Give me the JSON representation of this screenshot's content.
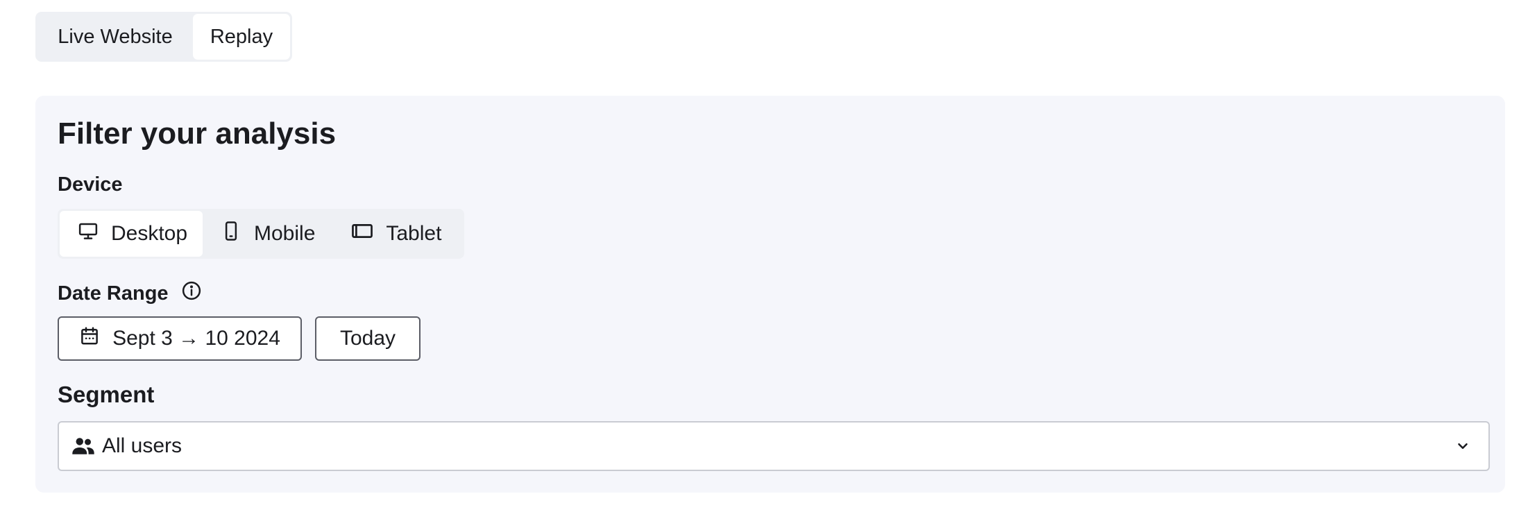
{
  "mode_toggle": {
    "tabs": [
      {
        "label": "Live Website",
        "active": false
      },
      {
        "label": "Replay",
        "active": true
      }
    ]
  },
  "filter_panel": {
    "title": "Filter your analysis",
    "device": {
      "label": "Device",
      "options": [
        {
          "label": "Desktop",
          "icon": "desktop-icon",
          "active": true
        },
        {
          "label": "Mobile",
          "icon": "mobile-icon",
          "active": false
        },
        {
          "label": "Tablet",
          "icon": "tablet-icon",
          "active": false
        }
      ]
    },
    "date_range": {
      "label": "Date Range",
      "info_icon": "info-icon",
      "range_button": "Sept 3 → 10 2024",
      "today_button": "Today"
    },
    "segment": {
      "label": "Segment",
      "selected": "All users",
      "icon": "users-icon"
    }
  },
  "colors": {
    "panel_background": "#f5f6fb",
    "toggle_background": "#eef0f4",
    "text": "#1b1c20",
    "button_border": "#5b5d66"
  }
}
